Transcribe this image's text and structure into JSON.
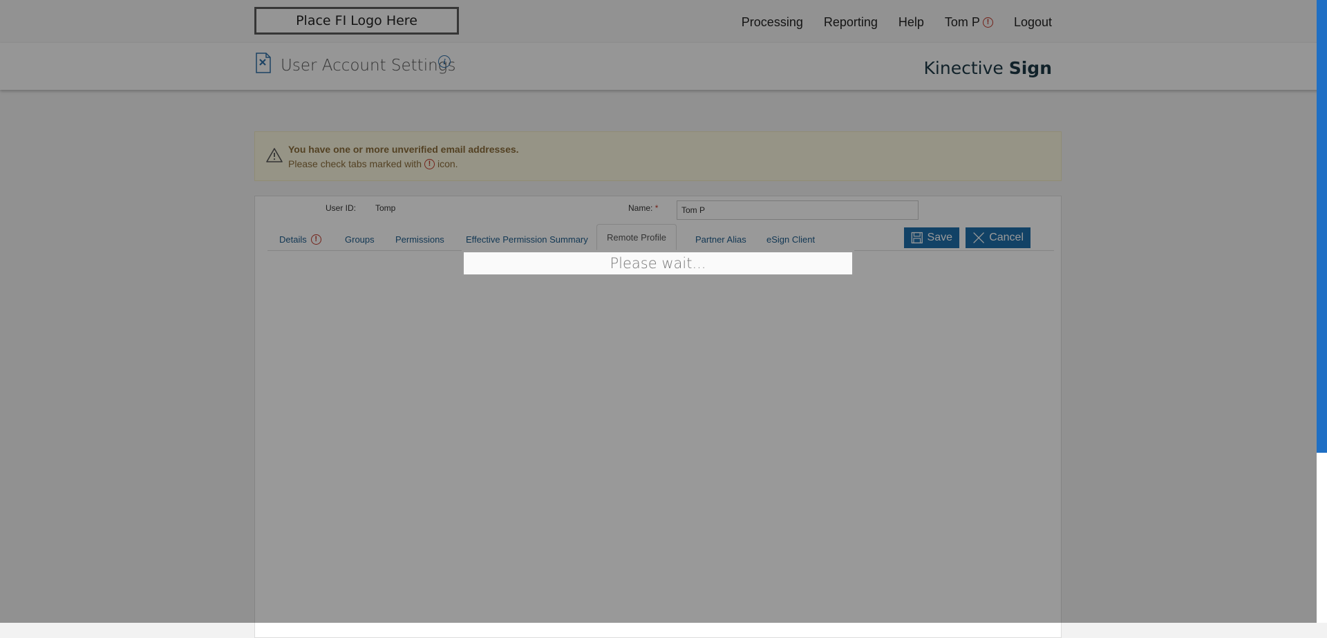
{
  "header": {
    "logo_text": "Place FI Logo Here",
    "nav": {
      "processing": "Processing",
      "reporting": "Reporting",
      "help": "Help",
      "user": "Tom P",
      "logout": "Logout"
    }
  },
  "subheader": {
    "title": "User Account Settings",
    "brand_light": "Kinective ",
    "brand_bold": "Sign"
  },
  "warning": {
    "line1": "You have one or more unverified email addresses.",
    "line2_prefix": "Please check tabs marked with",
    "line2_suffix": "icon."
  },
  "form": {
    "user_id_label": "User ID:",
    "user_id_value": "Tomp",
    "name_label": "Name:",
    "required_mark": "*",
    "name_value": "Tom P"
  },
  "tabs": {
    "details": "Details",
    "groups": "Groups",
    "permissions": "Permissions",
    "effective": "Effective Permission Summary",
    "remote": "Remote Profile",
    "partner": "Partner Alias",
    "esign": "eSign Client"
  },
  "buttons": {
    "save": "Save",
    "cancel": "Cancel"
  },
  "overlay": {
    "message": "Please wait..."
  },
  "colors": {
    "accent": "#1f6fab",
    "alert": "#c0392b",
    "warning_bg": "#fbf7df"
  }
}
